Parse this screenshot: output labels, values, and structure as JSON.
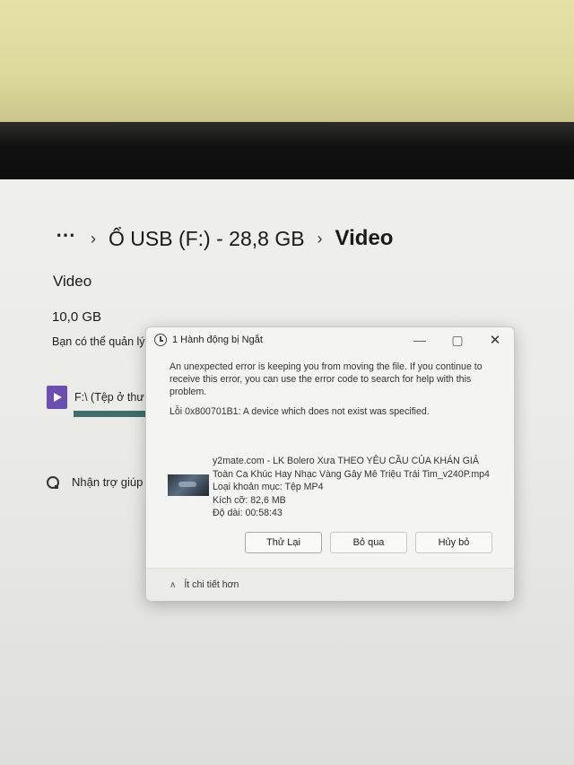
{
  "breadcrumb": {
    "overflow": "⋯",
    "separator": "›",
    "drive": "Ổ USB (F:) - 28,8 GB",
    "folder": "Video"
  },
  "section": {
    "title": "Video",
    "size": "10,0 GB",
    "manage_text": "Bạn có thể quản lý c"
  },
  "transfer": {
    "file_label": "F:\\ (Tệp ở thư m",
    "progress": 0.9
  },
  "help": {
    "label": "Nhận trợ giúp"
  },
  "dialog": {
    "title": "1 Hành động bị Ngắt",
    "minimize": "—",
    "maximize": "▢",
    "close": "✕",
    "message": "An unexpected error is keeping you from moving the file. If you continue to receive this error, you can use the error code to search for help with this problem.",
    "error_code": "Lỗi 0x800701B1: A device which does not exist was specified.",
    "file_name_line1": "y2mate.com - LK Bolero Xưa THEO YÊU CẦU CỦA KHÁN GIẢ",
    "file_name_line2": "Toàn Ca Khúc Hay  Nhạc Vàng Gây Mê Triệu Trái Tim_v240P.mp4",
    "file_type": "Loại khoản mục: Tệp MP4",
    "file_size": "Kích cỡ: 82,6 MB",
    "duration": "Độ dài: 00:58:43",
    "retry_label": "Thử Lại",
    "skip_label": "Bỏ qua",
    "cancel_label": "Hủy bỏ",
    "details_chevron": "∧",
    "details_label": "Ít chi tiết hơn"
  }
}
